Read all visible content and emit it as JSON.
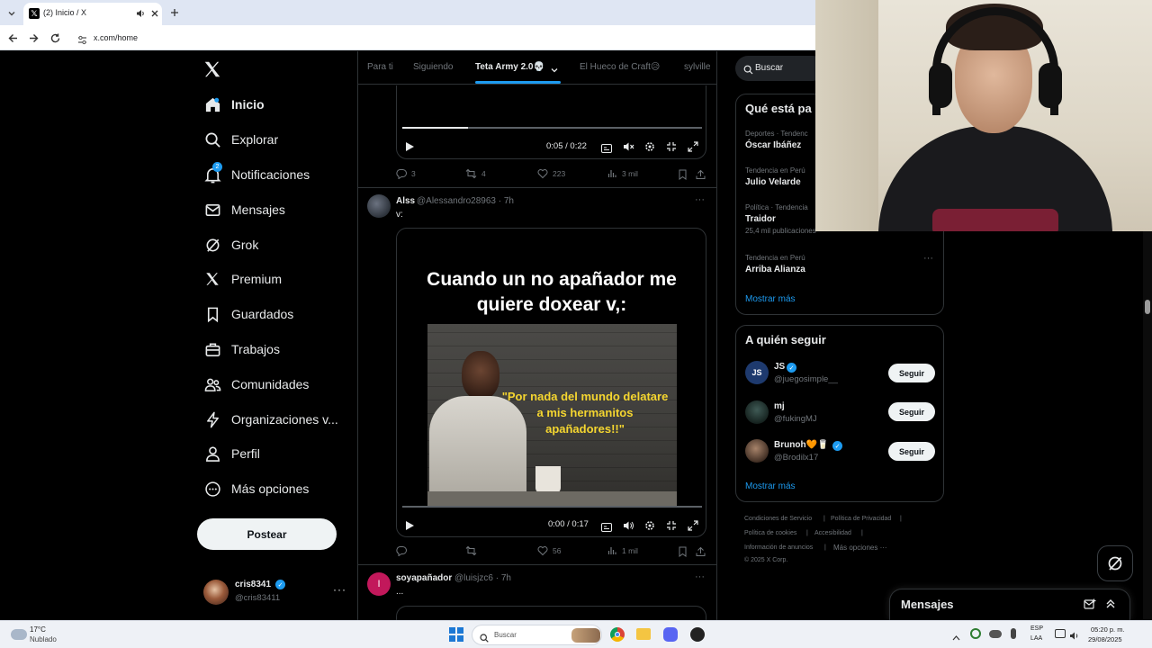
{
  "browser": {
    "tab_title": "(2) Inicio / X",
    "url": "x.com/home"
  },
  "sidebar": {
    "items": [
      {
        "label": "Inicio",
        "icon": "home-icon",
        "bold": true
      },
      {
        "label": "Explorar",
        "icon": "search-icon"
      },
      {
        "label": "Notificaciones",
        "icon": "bell-icon",
        "badge": "2"
      },
      {
        "label": "Mensajes",
        "icon": "mail-icon"
      },
      {
        "label": "Grok",
        "icon": "grok-icon"
      },
      {
        "label": "Premium",
        "icon": "x-logo-icon"
      },
      {
        "label": "Guardados",
        "icon": "bookmark-icon"
      },
      {
        "label": "Trabajos",
        "icon": "briefcase-icon"
      },
      {
        "label": "Comunidades",
        "icon": "people-icon"
      },
      {
        "label": "Organizaciones v...",
        "icon": "lightning-icon"
      },
      {
        "label": "Perfil",
        "icon": "person-icon"
      },
      {
        "label": "Más opciones",
        "icon": "more-circle-icon"
      }
    ],
    "post_button": "Postear",
    "account": {
      "name": "cris8341",
      "handle": "@cris83411"
    }
  },
  "timeline_tabs": [
    {
      "label": "Para ti",
      "active": false
    },
    {
      "label": "Siguiendo",
      "active": false
    },
    {
      "label": "Teta Army 2.0💀",
      "active": true
    },
    {
      "label": "El Hueco de Craft😥",
      "active": false
    },
    {
      "label": "sylville",
      "active": false
    }
  ],
  "tweet1": {
    "video_time": "0:05 / 0:22",
    "progress": 0.22,
    "replies": "3",
    "reposts": "4",
    "likes": "223",
    "views": "3 mil"
  },
  "tweet2": {
    "name": "Alss",
    "handle_time": "@Alessandro28963 · 7h",
    "text": "v:",
    "meme_caption": "Cuando un no apañador me quiere doxear v,:",
    "meme_quote": "\"Por nada del mundo delatare a mis hermanitos apañadores!!\"",
    "video_time": "0:00 / 0:17",
    "replies": "",
    "reposts": "",
    "likes": "56",
    "views": "1 mil"
  },
  "tweet3": {
    "avatar_letter": "I",
    "name": "soyapañador",
    "handle_time": "@luisjzc6 · 7h",
    "text": "..."
  },
  "search": {
    "placeholder": "Buscar"
  },
  "trends": {
    "title": "Qué está pa",
    "items": [
      {
        "category": "Deportes · Tendenc",
        "name": "Óscar Ibáñez",
        "posts": ""
      },
      {
        "category": "Tendencia en Perú",
        "name": "Julio Velarde",
        "posts": ""
      },
      {
        "category": "Política · Tendencia",
        "name": "Traidor",
        "posts": "25,4 mil publicaciones"
      },
      {
        "category": "Tendencia en Perú",
        "name": "Arriba Alianza",
        "posts": ""
      }
    ],
    "show_more": "Mostrar más"
  },
  "who_to_follow": {
    "title": "A quién seguir",
    "items": [
      {
        "name": "JS",
        "handle": "@juegosimple__",
        "verified": true,
        "button": "Seguir"
      },
      {
        "name": "mj",
        "handle": "@fukingMJ",
        "verified": false,
        "button": "Seguir"
      },
      {
        "name": "Brunoh🧡🥛",
        "handle": "@Brodilx17",
        "verified": true,
        "button": "Seguir"
      }
    ],
    "show_more": "Mostrar más"
  },
  "footer": {
    "links": [
      "Condiciones de Servicio",
      "Política de Privacidad",
      "Política de cookies",
      "Accesibilidad",
      "Información de anuncios",
      "Más opciones ···"
    ],
    "copyright": "© 2025 X Corp."
  },
  "messages_drawer": {
    "title": "Mensajes"
  },
  "taskbar": {
    "weather_temp": "17°C",
    "weather_desc": "Nublado",
    "search": "Buscar",
    "lang1": "ESP",
    "lang2": "LAA",
    "time": "05:20 p. m.",
    "date": "29/08/2025"
  },
  "colors": {
    "accent": "#1d9bf0",
    "background": "#000000",
    "border": "#2f3336",
    "muted": "#71767b"
  }
}
